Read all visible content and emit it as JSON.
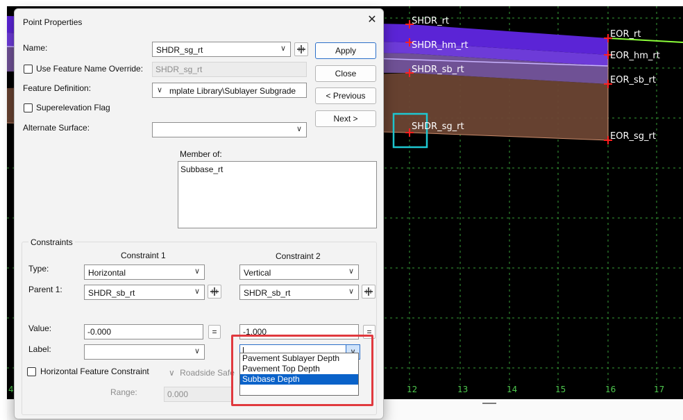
{
  "dialog": {
    "title": "Point Properties",
    "close_glyph": "✕",
    "name_label": "Name:",
    "name_value": "SHDR_sg_rt",
    "use_override_label": "Use Feature Name Override:",
    "override_value": "SHDR_sg_rt",
    "feature_def_label": "Feature Definition:",
    "feature_def_value": "mplate Library\\Sublayer Subgrade",
    "superelevation_label": "Superelevation Flag",
    "alternate_surface_label": "Alternate Surface:",
    "alternate_surface_value": "",
    "member_of_label": "Member of:",
    "member_of_items": [
      "Subbase_rt"
    ],
    "buttons": {
      "apply": "Apply",
      "close": "Close",
      "previous": "< Previous",
      "next": "Next >"
    },
    "constraints": {
      "group_label": "Constraints",
      "c1_header": "Constraint 1",
      "c2_header": "Constraint 2",
      "type_label": "Type:",
      "parent1_label": "Parent 1:",
      "value_label": "Value:",
      "label_label": "Label:",
      "c1_type": "Horizontal",
      "c2_type": "Vertical",
      "c1_parent": "SHDR_sb_rt",
      "c2_parent": "SHDR_sb_rt",
      "c1_value": "-0.000",
      "c2_value": "-1.000",
      "c1_label": "",
      "c2_label": "",
      "equals": "=",
      "hfc_label": "Horizontal Feature Constraint",
      "hfc_value": "Roadside Safe",
      "range_label": "Range:",
      "range_value": "0.000"
    }
  },
  "dropdown": {
    "options": [
      "Pavement Sublayer Depth",
      "Pavement Top Depth",
      "Subbase Depth"
    ],
    "selected_index": 2
  },
  "viewport": {
    "point_labels": {
      "shdr_rt": "SHDR_rt",
      "shdr_hm_rt": "SHDR_hm_rt",
      "shdr_sb_rt": "SHDR_sb_rt",
      "shdr_sg_rt": "SHDR_sg_rt",
      "eor_rt": "EOR_rt",
      "eor_hm_rt": "EOR_hm_rt",
      "eor_sb_rt": "EOR_sb_rt",
      "eor_sg_rt": "EOR_sg_rt"
    },
    "x_ticks": [
      "12",
      "13",
      "14",
      "15",
      "16",
      "17"
    ],
    "left_tick": "4"
  },
  "colors": {
    "layer_top": "#5b24d6",
    "layer_hm": "#6d3bd8",
    "layer_sb": "#6f5195",
    "layer_sg": "#6b4433",
    "grid": "#3fb33f",
    "selection_box": "#1ec8d2",
    "highlight": "#e0393e"
  }
}
